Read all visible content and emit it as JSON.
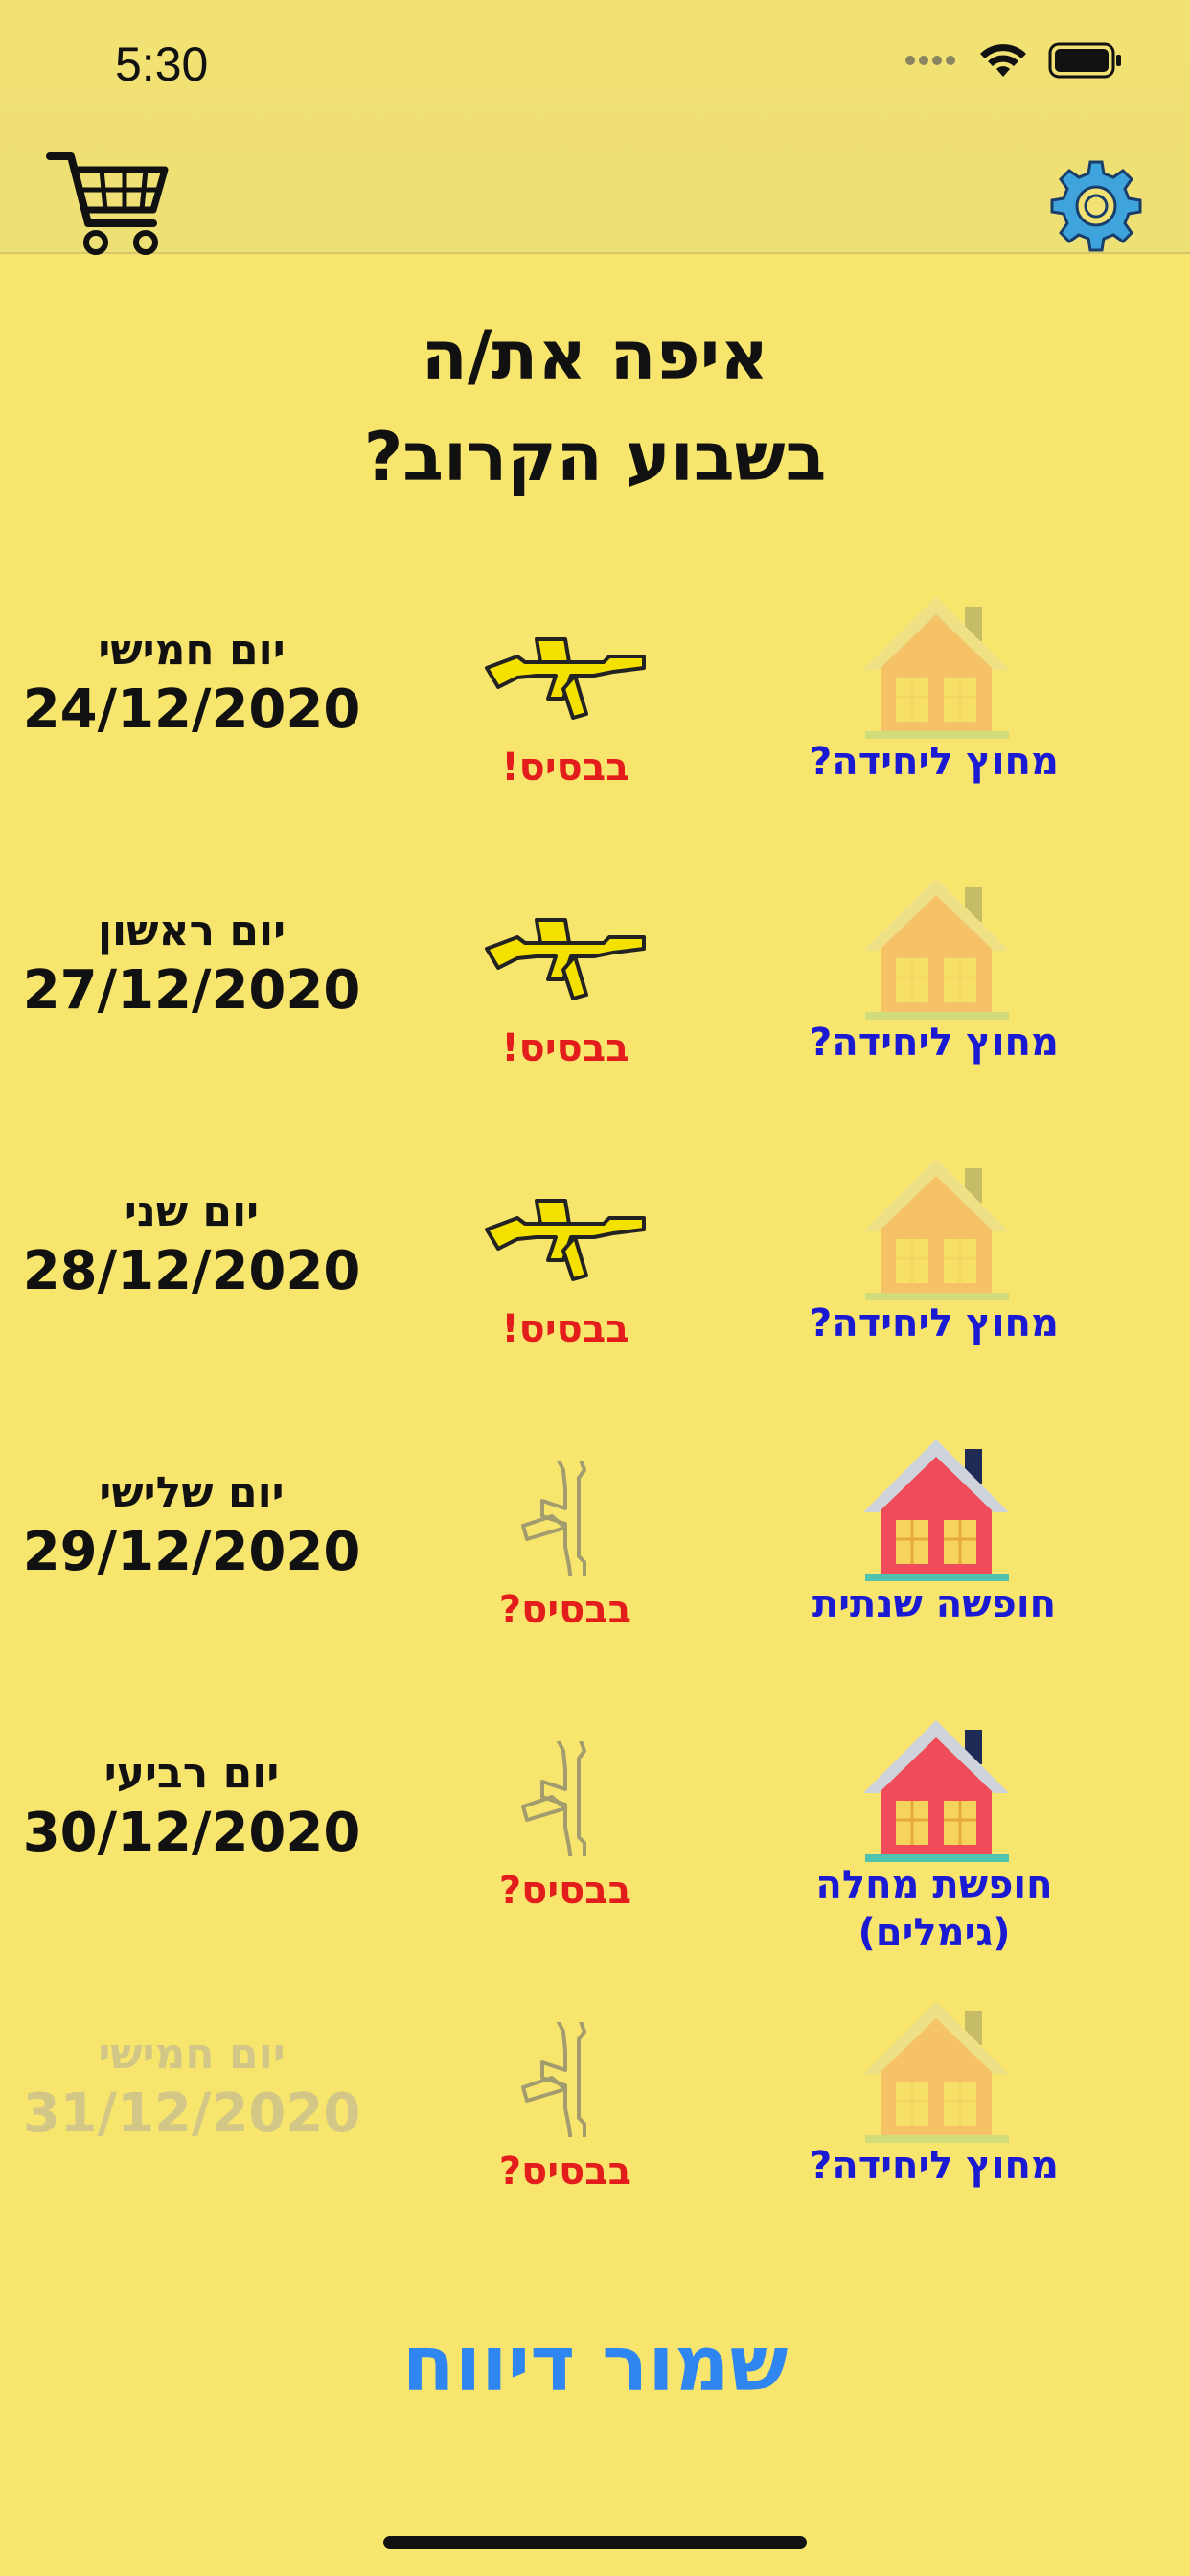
{
  "status_bar": {
    "time": "5:30"
  },
  "nav": {
    "cart_icon": "cart-icon",
    "settings_icon": "gear-icon"
  },
  "title_line1": "איפה את/ה",
  "title_line2": "בשבוע הקרוב?",
  "rows": [
    {
      "day": "יום חמישי",
      "date": "24/12/2020",
      "base_label": "בבסיס!",
      "location_label": "מחוץ ליחידה?",
      "base_active": true,
      "home_active": false,
      "faded": false
    },
    {
      "day": "יום ראשון",
      "date": "27/12/2020",
      "base_label": "בבסיס!",
      "location_label": "מחוץ ליחידה?",
      "base_active": true,
      "home_active": false,
      "faded": false
    },
    {
      "day": "יום שני",
      "date": "28/12/2020",
      "base_label": "בבסיס!",
      "location_label": "מחוץ ליחידה?",
      "base_active": true,
      "home_active": false,
      "faded": false
    },
    {
      "day": "יום שלישי",
      "date": "29/12/2020",
      "base_label": "בבסיס?",
      "location_label": "חופשה שנתית",
      "base_active": false,
      "home_active": true,
      "faded": false
    },
    {
      "day": "יום רביעי",
      "date": "30/12/2020",
      "base_label": "בבסיס?",
      "location_label": "חופשת מחלה\n(גימלים)",
      "base_active": false,
      "home_active": true,
      "faded": false
    },
    {
      "day": "יום חמישי",
      "date": "31/12/2020",
      "base_label": "בבסיס?",
      "location_label": "מחוץ ליחידה?",
      "base_active": false,
      "home_active": false,
      "faded": true
    }
  ],
  "save_label": "שמור דיווח",
  "colors": {
    "background": "#f7e56d",
    "base_label": "#e31c1c",
    "location_label": "#1a1ad2",
    "save": "#2f86f0"
  }
}
